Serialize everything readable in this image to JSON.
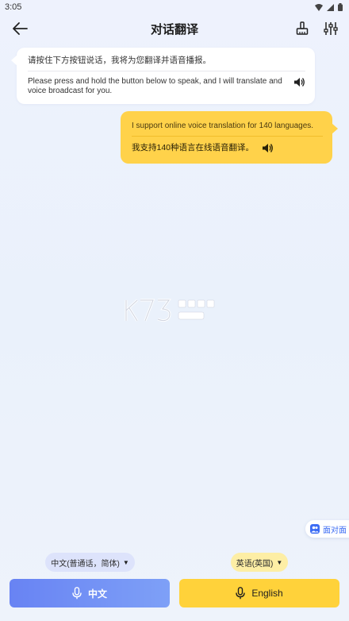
{
  "status_bar": {
    "time": "3:05"
  },
  "app_bar": {
    "title": "对话翻译"
  },
  "messages": {
    "left": {
      "source": "请按住下方按钮说话，我将为您翻译并语音播报。",
      "target": "Please press and hold the button below to speak, and I will translate and voice broadcast for you."
    },
    "right": {
      "source": "I support online voice translation for 140 languages.",
      "target": "我支持140种语言在线语音翻译。"
    }
  },
  "face_to_face": {
    "label": "面对面"
  },
  "language_selectors": {
    "left": {
      "label": "中文(普通话，简体)"
    },
    "right": {
      "label": "英语(英国)"
    }
  },
  "mic_buttons": {
    "left": {
      "label": "中文"
    },
    "right": {
      "label": "English"
    }
  },
  "colors": {
    "accent_blue": "#6883f3",
    "accent_yellow": "#ffd23a",
    "face_blue": "#3c6cf4"
  }
}
